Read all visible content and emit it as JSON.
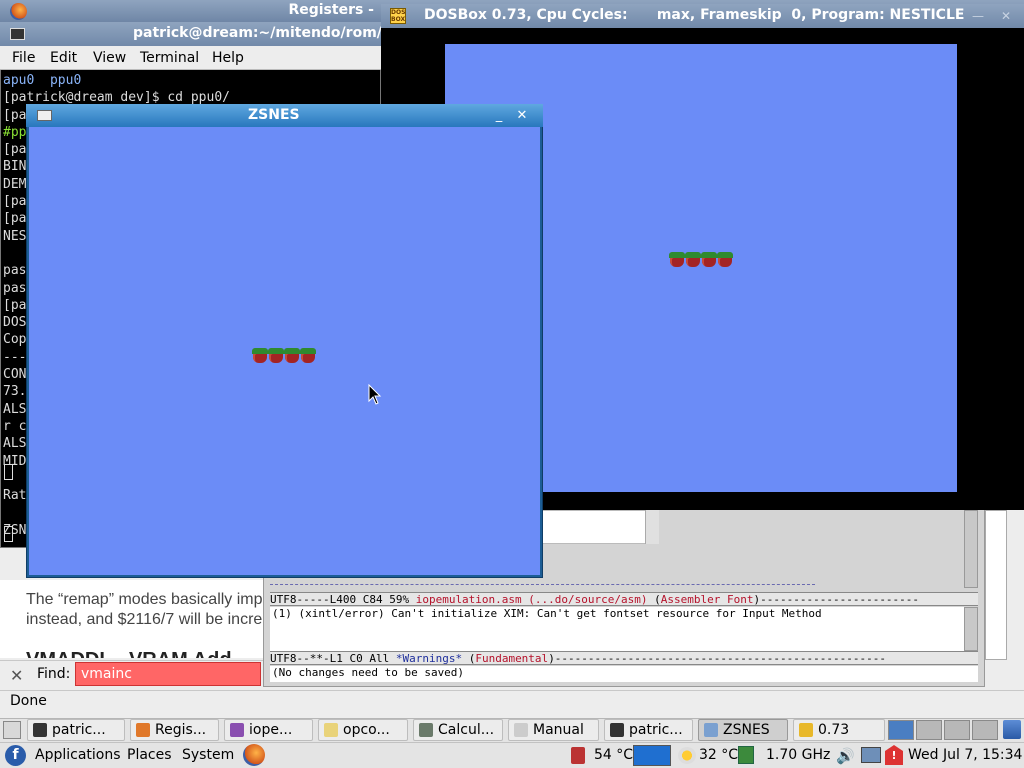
{
  "firefox": {
    "title": "Registers -",
    "text_line1": "The “remap” modes basically impl",
    "text_line2": "instead, and $2116/7 will be increr",
    "heading": "VMADDL - VRAM Add",
    "find_label": "Find:",
    "find_value": "vmainc",
    "status": "Done"
  },
  "terminal": {
    "title": "patrick@dream:~/mitendo/rom/",
    "menu": [
      "File",
      "Edit",
      "View",
      "Terminal",
      "Help"
    ],
    "lines": [
      {
        "text": "apu0  ppu0",
        "color": "blue"
      },
      {
        "text": "[patrick@dream dev]$ cd ppu0/",
        "color": "normal"
      },
      {
        "text": "[pa",
        "color": "normal"
      },
      {
        "text": "#pp",
        "color": "green"
      },
      {
        "text": "[pa",
        "color": "normal"
      },
      {
        "text": "BIN",
        "color": "normal"
      },
      {
        "text": "DEM",
        "color": "normal"
      },
      {
        "text": "[pa",
        "color": "normal"
      },
      {
        "text": "[pa",
        "color": "normal"
      },
      {
        "text": "NES",
        "color": "normal"
      },
      {
        "text": "",
        "color": "normal"
      },
      {
        "text": "pas",
        "color": "normal"
      },
      {
        "text": "pas",
        "color": "normal"
      },
      {
        "text": "[pa",
        "color": "normal"
      },
      {
        "text": "DOS",
        "color": "normal"
      },
      {
        "text": "Cop",
        "color": "normal"
      },
      {
        "text": "---",
        "color": "normal"
      },
      {
        "text": "CON",
        "color": "normal"
      },
      {
        "text": "73.",
        "color": "normal"
      },
      {
        "text": "ALS",
        "color": "normal"
      },
      {
        "text": "r c",
        "color": "normal"
      },
      {
        "text": "ALS",
        "color": "normal"
      },
      {
        "text": "MID",
        "color": "normal"
      },
      {
        "text": "",
        "color": "normal"
      },
      {
        "text": "Rat",
        "color": "normal"
      },
      {
        "text": "",
        "color": "normal"
      },
      {
        "text": "ZSN",
        "color": "normal"
      }
    ]
  },
  "dosbox": {
    "title": "DOSBox 0.73, Cpu Cycles:      max, Frameskip  0, Program: NESTICLE",
    "icon_label": "DOS BOX",
    "sprite_count": 4
  },
  "zsnes": {
    "title": "ZSNES",
    "sprite_count": 4
  },
  "emacs": {
    "modeline1": {
      "prefix": "UTF8-----L400 C84 59%  ",
      "buffer": "iopemulation.asm (...do/source/asm)",
      "mode_open": "  (",
      "mode1": "Assembler",
      "mode2": "Font",
      "mode_close": ")------------------------"
    },
    "message": "(1) (xintl/error) Can't initialize XIM: Can't get fontset resource for Input Method",
    "modeline2": {
      "prefix": "UTF8--**-L1 C0 All     ",
      "buffer": "*Warnings*",
      "mode_open": "  (",
      "mode": "Fundamental",
      "mode_close": ")--------------------------------------------------"
    },
    "minibuffer": "(No changes need to be saved)"
  },
  "taskbar": {
    "tasks": [
      {
        "label": "patric...",
        "icon": "terminal-icon",
        "active": false
      },
      {
        "label": "Regis...",
        "icon": "firefox-icon",
        "active": false
      },
      {
        "label": "iope...",
        "icon": "emacs-icon",
        "active": false
      },
      {
        "label": "opco...",
        "icon": "editor-icon",
        "active": false
      },
      {
        "label": "Calcul...",
        "icon": "calculator-icon",
        "active": false
      },
      {
        "label": "Manual",
        "icon": "document-icon",
        "active": false
      },
      {
        "label": "patric...",
        "icon": "terminal-icon",
        "active": false
      },
      {
        "label": "ZSNES",
        "icon": "window-icon",
        "active": true
      },
      {
        "label": "0.73",
        "icon": "dosbox-icon",
        "active": false
      }
    ]
  },
  "panel": {
    "menus": [
      "Applications",
      "Places",
      "System"
    ],
    "temp_cpu": "54 °C",
    "temp_weather": "32 °C",
    "cpu_freq": "1.70 GHz",
    "clock": "Wed Jul  7, 15:34"
  }
}
